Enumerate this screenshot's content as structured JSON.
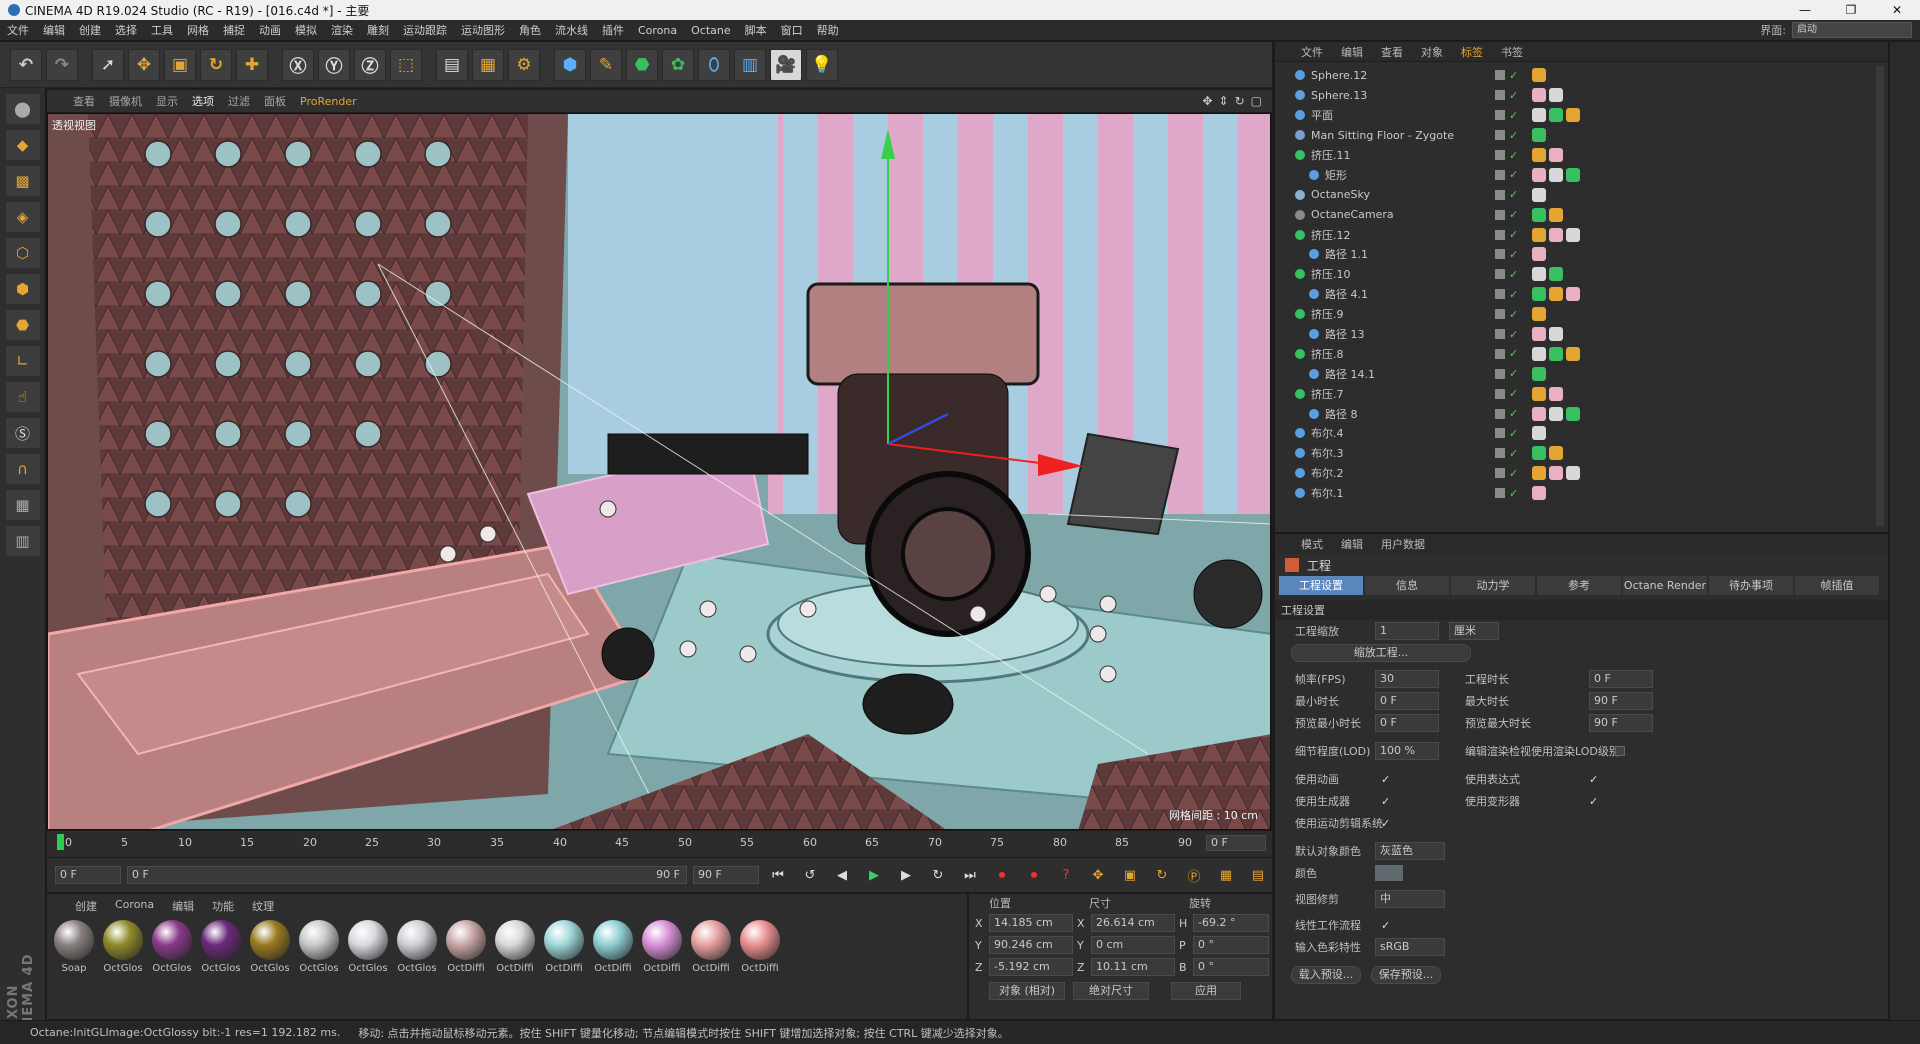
{
  "window": {
    "title": "CINEMA 4D R19.024 Studio (RC - R19) - [016.c4d *] - 主要"
  },
  "menubar": {
    "items": [
      "文件",
      "编辑",
      "创建",
      "选择",
      "工具",
      "网格",
      "捕捉",
      "动画",
      "模拟",
      "渲染",
      "雕刻",
      "运动跟踪",
      "运动图形",
      "角色",
      "流水线",
      "插件",
      "Corona",
      "Octane",
      "脚本",
      "窗口",
      "帮助"
    ],
    "interface_label": "界面:",
    "interface_value": "启动"
  },
  "viewport": {
    "menu": [
      "查看",
      "摄像机",
      "显示",
      "选项",
      "过滤",
      "面板",
      "ProRender"
    ],
    "label": "透视视图",
    "grid_spacing": "网格间距 : 10 cm"
  },
  "timeline": {
    "ticks": [
      "0",
      "5",
      "10",
      "15",
      "20",
      "25",
      "30",
      "35",
      "40",
      "45",
      "50",
      "55",
      "60",
      "65",
      "70",
      "75",
      "80",
      "85",
      "90"
    ],
    "current_frame": "0 F"
  },
  "transport": {
    "start": "0 F",
    "range_start": "0 F",
    "range_end": "90 F",
    "end": "90 F"
  },
  "materials": {
    "menu": [
      "创建",
      "Corona",
      "编辑",
      "功能",
      "纹理"
    ],
    "items": [
      {
        "name": "Soap",
        "color": "#8a8080"
      },
      {
        "name": "OctGlos",
        "color": "#8f8a2a"
      },
      {
        "name": "OctGlos",
        "color": "#8a3a8a"
      },
      {
        "name": "OctGlos",
        "color": "#6a2a7a"
      },
      {
        "name": "OctGlos",
        "color": "#9a7a20"
      },
      {
        "name": "OctGlos",
        "color": "#c8c8c8"
      },
      {
        "name": "OctGlos",
        "color": "#d8d8e0"
      },
      {
        "name": "OctGlos",
        "color": "#cfcfd5"
      },
      {
        "name": "OctDiffi",
        "color": "#c9a6a6"
      },
      {
        "name": "OctDiffi",
        "color": "#d8d8d8"
      },
      {
        "name": "OctDiffi",
        "color": "#9fd8da"
      },
      {
        "name": "OctDiffi",
        "color": "#8fd0d6"
      },
      {
        "name": "OctDiffi",
        "color": "#d890d8"
      },
      {
        "name": "OctDiffi",
        "color": "#e8a0a0"
      },
      {
        "name": "OctDiffi",
        "color": "#ea9090"
      }
    ]
  },
  "coordinates": {
    "headers": [
      "位置",
      "尺寸",
      "旋转"
    ],
    "rows": [
      {
        "pos_axis": "X",
        "pos": "14.185 cm",
        "size_axis": "X",
        "size": "26.614 cm",
        "rot_axis": "H",
        "rot": "-69.2 °"
      },
      {
        "pos_axis": "Y",
        "pos": "90.246 cm",
        "size_axis": "Y",
        "size": "0 cm",
        "rot_axis": "P",
        "rot": "0 °"
      },
      {
        "pos_axis": "Z",
        "pos": "-5.192 cm",
        "size_axis": "Z",
        "size": "10.11 cm",
        "rot_axis": "B",
        "rot": "0 °"
      }
    ],
    "mode": "对象 (相对)",
    "size_mode": "绝对尺寸",
    "apply": "应用"
  },
  "status": {
    "left": "Octane:InitGLImage:OctGlossy bit:-1 res=1 192.182 ms.",
    "hint": "移动: 点击并拖动鼠标移动元素。按住 SHIFT 键量化移动; 节点编辑模式时按住 SHIFT 键增加选择对象; 按住 CTRL 键减少选择对象。"
  },
  "object_manager": {
    "menu": [
      "文件",
      "编辑",
      "查看",
      "对象",
      "标签",
      "书签"
    ],
    "active_menu": "标签",
    "objects": [
      {
        "name": "Sphere.12",
        "icon": "#5aa0e0"
      },
      {
        "name": "Sphere.13",
        "icon": "#5aa0e0"
      },
      {
        "name": "平面",
        "icon": "#5aa0e0"
      },
      {
        "name": "Man Sitting Floor - Zygote",
        "icon": "#7aa0d0"
      },
      {
        "name": "挤压.11",
        "icon": "#38c060"
      },
      {
        "name": "矩形",
        "icon": "#5aa0e0"
      },
      {
        "name": "OctaneSky",
        "icon": "#8ab0d0"
      },
      {
        "name": "OctaneCamera",
        "icon": "#8a8a8a"
      },
      {
        "name": "挤压.12",
        "icon": "#38c060"
      },
      {
        "name": "路径 1.1",
        "icon": "#5aa0e0"
      },
      {
        "name": "挤压.10",
        "icon": "#38c060"
      },
      {
        "name": "路径 4.1",
        "icon": "#5aa0e0"
      },
      {
        "name": "挤压.9",
        "icon": "#38c060"
      },
      {
        "name": "路径 13",
        "icon": "#5aa0e0"
      },
      {
        "name": "挤压.8",
        "icon": "#38c060"
      },
      {
        "name": "路径 14.1",
        "icon": "#5aa0e0"
      },
      {
        "name": "挤压.7",
        "icon": "#38c060"
      },
      {
        "name": "路径 8",
        "icon": "#5aa0e0"
      },
      {
        "name": "布尔.4",
        "icon": "#5aa0e0"
      },
      {
        "name": "布尔.3",
        "icon": "#5aa0e0"
      },
      {
        "name": "布尔.2",
        "icon": "#5aa0e0"
      },
      {
        "name": "布尔.1",
        "icon": "#5aa0e0"
      }
    ]
  },
  "attributes": {
    "menu": [
      "模式",
      "编辑",
      "用户数据"
    ],
    "title": "工程",
    "tabs": [
      "工程设置",
      "信息",
      "动力学",
      "参考",
      "Octane Render",
      "待办事项",
      "帧插值"
    ],
    "section": "工程设置",
    "project_scale_label": "工程缩放",
    "project_scale_value": "1",
    "project_scale_unit": "厘米",
    "scale_button": "缩放工程...",
    "fps_label": "帧率(FPS)",
    "fps_value": "30",
    "duration_label": "工程时长",
    "duration_value": "0 F",
    "min_time_label": "最小时长",
    "min_time_value": "0 F",
    "max_time_label": "最大时长",
    "max_time_value": "90 F",
    "preview_min_label": "预览最小时长",
    "preview_min_value": "0 F",
    "preview_max_label": "预览最大时长",
    "preview_max_value": "90 F",
    "lod_label": "细节程度(LOD)",
    "lod_value": "100 %",
    "lod_render_label": "编辑渲染检视使用渲染LOD级别",
    "use_anim_label": "使用动画",
    "use_expr_label": "使用表达式",
    "use_gen_label": "使用生成器",
    "use_deform_label": "使用变形器",
    "use_motion_label": "使用运动剪辑系统",
    "default_color_label": "默认对象颜色",
    "default_color_value": "灰蓝色",
    "color_label": "颜色",
    "view_clip_label": "视图修剪",
    "view_clip_value": "中",
    "linear_label": "线性工作流程",
    "input_color_label": "输入色彩特性",
    "input_color_value": "sRGB",
    "load_preset": "载入预设...",
    "save_preset": "保存预设..."
  }
}
